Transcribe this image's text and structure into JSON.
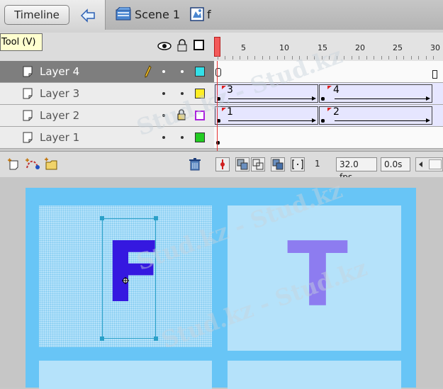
{
  "header": {
    "timeline_label": "Timeline",
    "scene_label": "Scene 1",
    "symbol_label": "f"
  },
  "tooltip": {
    "text": "Tool (V)"
  },
  "ruler": {
    "labels": [
      "5",
      "10",
      "15",
      "20",
      "25",
      "30"
    ]
  },
  "layers": [
    {
      "name": "Layer 4",
      "selected": true,
      "color": "#33e0e8"
    },
    {
      "name": "Layer 3",
      "selected": false,
      "color": "#ffee22"
    },
    {
      "name": "Layer 2",
      "selected": false,
      "color": "#aa22dd",
      "locked": true
    },
    {
      "name": "Layer 1",
      "selected": false,
      "color": "#22cc22"
    }
  ],
  "frame_labels": {
    "layer3_a": "3",
    "layer3_b": "4",
    "layer2_a": "1",
    "layer2_b": "2"
  },
  "status": {
    "frame": "1",
    "fps": "32.0 fps",
    "time": "0.0s"
  },
  "stage": {
    "letter_left": "F",
    "letter_right": "T",
    "letter_left_color": "#3518e0",
    "letter_right_color": "#8d7cf0"
  },
  "watermark": "Stud.kz - Stud.kz"
}
